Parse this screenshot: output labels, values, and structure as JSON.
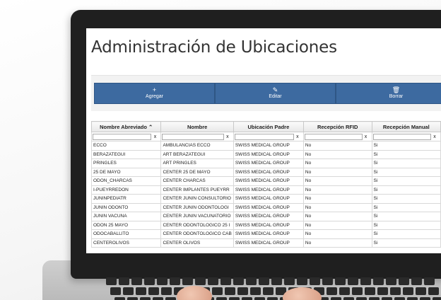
{
  "page": {
    "title": "Administración de Ubicaciones"
  },
  "toolbar": {
    "buttons": [
      {
        "label": "Agregar",
        "icon": "+"
      },
      {
        "label": "Editar",
        "icon": "✎"
      },
      {
        "label": "Borrar",
        "icon": "🗑"
      }
    ]
  },
  "grid": {
    "columns": [
      {
        "label": "Nombre Abreviado",
        "sort_icon": "⌃"
      },
      {
        "label": "Nombre",
        "sort_icon": ""
      },
      {
        "label": "Ubicación Padre",
        "sort_icon": ""
      },
      {
        "label": "Recepción RFID",
        "sort_icon": ""
      },
      {
        "label": "Recepción Manual",
        "sort_icon": ""
      }
    ],
    "filter_clear": "x",
    "rows": [
      [
        "ECCO",
        "AMBULANCIAS ECCO",
        "SWISS MEDICAL GROUP",
        "No",
        "Si"
      ],
      [
        "BERAZATEGUI",
        "ART BERAZATEGUI",
        "SWISS MEDICAL GROUP",
        "No",
        "Si"
      ],
      [
        "PRINGLES",
        "ART PRINGLES",
        "SWISS MEDICAL GROUP",
        "No",
        "Si"
      ],
      [
        "25 DE MAYO",
        "CENTER 25 DE MAYO",
        "SWISS MEDICAL GROUP",
        "No",
        "Si"
      ],
      [
        "ODON_CHARCAS",
        "CENTER CHARCAS",
        "SWISS MEDICAL GROUP",
        "No",
        "Si"
      ],
      [
        "I-PUEYRREDON",
        "CENTER IMPLANTES PUEYRR",
        "SWISS MEDICAL GROUP",
        "No",
        "Si"
      ],
      [
        "JUNINPEDIATR",
        "CENTER JUNIN CONSULTORIO",
        "SWISS MEDICAL GROUP",
        "No",
        "Si"
      ],
      [
        "JUNIN ODONTO",
        "CENTER JUNIN ODONTOLOGI",
        "SWISS MEDICAL GROUP",
        "No",
        "Si"
      ],
      [
        "JUNIN VACUNA",
        "CENTER JUNIN VACUNATORIO",
        "SWISS MEDICAL GROUP",
        "No",
        "Si"
      ],
      [
        "ODON 25 MAYO",
        "CENTER ODONTOLOGICO 25 I",
        "SWISS MEDICAL GROUP",
        "No",
        "Si"
      ],
      [
        "ODOCABALLITO",
        "CENTER ODONTOLOGICO CAB",
        "SWISS MEDICAL GROUP",
        "No",
        "Si"
      ],
      [
        "CENTEROLIVOS",
        "CENTER OLIVOS",
        "SWISS MEDICAL GROUP",
        "No",
        "Si"
      ]
    ]
  }
}
